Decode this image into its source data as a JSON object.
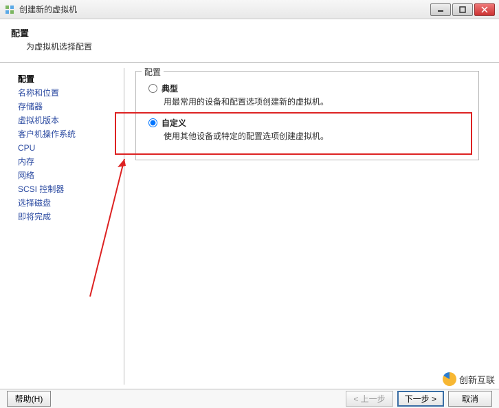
{
  "window": {
    "title": "创建新的虚拟机"
  },
  "header": {
    "title": "配置",
    "subtitle": "为虚拟机选择配置"
  },
  "sidebar": {
    "items": [
      "配置",
      "名称和位置",
      "存储器",
      "虚拟机版本",
      "客户机操作系统",
      "CPU",
      "内存",
      "网络",
      "SCSI 控制器",
      "选择磁盘",
      "即将完成"
    ],
    "active_index": 0
  },
  "content": {
    "group_label": "配置",
    "options": [
      {
        "title": "典型",
        "desc": "用最常用的设备和配置选项创建新的虚拟机。",
        "selected": false
      },
      {
        "title": "自定义",
        "desc": "使用其他设备或特定的配置选项创建虚拟机。",
        "selected": true
      }
    ]
  },
  "footer": {
    "help": "帮助(H)",
    "back": "< 上一步",
    "next": "下一步 >",
    "cancel": "取消"
  },
  "watermark": "创新互联"
}
